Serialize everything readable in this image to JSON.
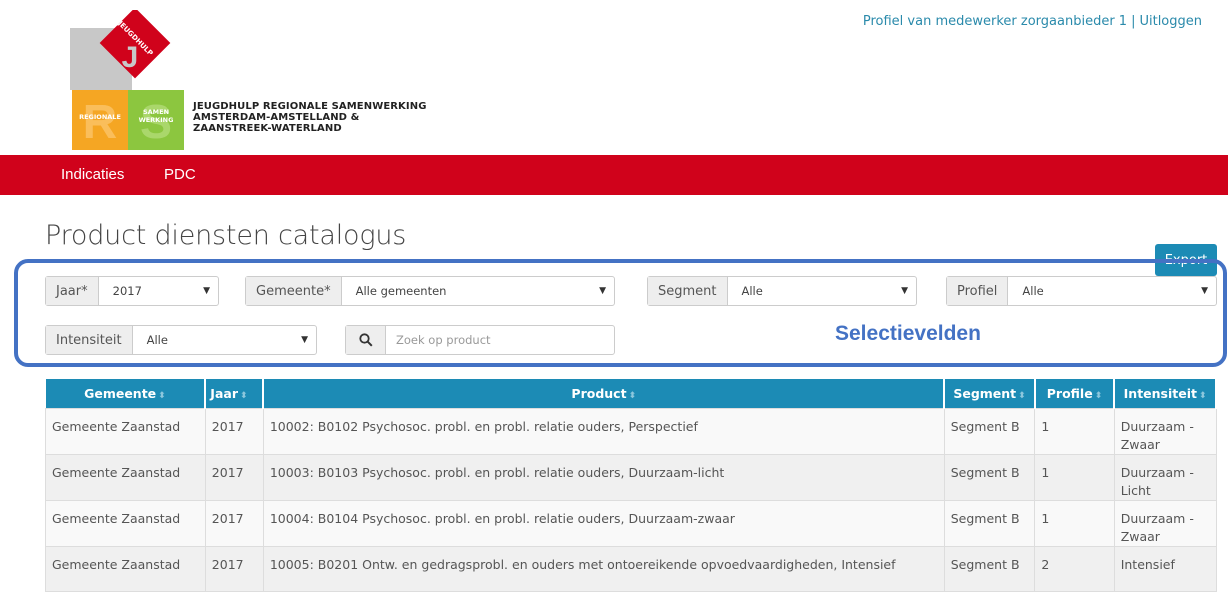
{
  "user_nav": {
    "profile_link": "Profiel van medewerker zorgaanbieder 1",
    "separator": "|",
    "logout_link": "Uitloggen"
  },
  "logo": {
    "badge_top": "JEUGDHULP",
    "letter_u": "J",
    "letter_r": "R",
    "letter_s": "S",
    "badge_left": "REGIONALE",
    "badge_right_1": "SAMEN",
    "badge_right_2": "WERKING",
    "text_lines": [
      "JEUGDHULP REGIONALE SAMENWERKING",
      "AMSTERDAM-AMSTELLAND &",
      "ZAANSTREEK-WATERLAND"
    ],
    "colors": {
      "red": "#d0021b",
      "grey": "#c8c8c8",
      "orange": "#f5a623",
      "green": "#8cc63f"
    }
  },
  "nav": {
    "items": [
      "Indicaties",
      "PDC"
    ],
    "color": "#d0021b"
  },
  "page": {
    "title": "Product diensten catalogus",
    "export_label": "Export"
  },
  "filters": {
    "jaar": {
      "label": "Jaar*",
      "value": "2017"
    },
    "gemeente": {
      "label": "Gemeente*",
      "value": "Alle gemeenten"
    },
    "segment": {
      "label": "Segment",
      "value": "Alle"
    },
    "profiel": {
      "label": "Profiel",
      "value": "Alle"
    },
    "intensiteit": {
      "label": "Intensiteit",
      "value": "Alle"
    },
    "search": {
      "placeholder": "Zoek op product"
    },
    "annotation": "Selectievelden"
  },
  "table": {
    "headers": [
      "Gemeente",
      "Jaar",
      "Product",
      "Segment",
      "Profile",
      "Intensiteit"
    ],
    "rows": [
      [
        "Gemeente Zaanstad",
        "2017",
        "10002: B0102 Psychosoc. probl. en probl. relatie ouders, Perspectief",
        "Segment B",
        "1",
        "Duurzaam - Zwaar"
      ],
      [
        "Gemeente Zaanstad",
        "2017",
        "10003: B0103 Psychosoc. probl. en probl. relatie ouders, Duurzaam-licht",
        "Segment B",
        "1",
        "Duurzaam - Licht"
      ],
      [
        "Gemeente Zaanstad",
        "2017",
        "10004: B0104 Psychosoc. probl. en probl. relatie ouders, Duurzaam-zwaar",
        "Segment B",
        "1",
        "Duurzaam - Zwaar"
      ],
      [
        "Gemeente Zaanstad",
        "2017",
        "10005: B0201 Ontw. en gedragsprobl. en ouders met ontoereikende opvoedvaardigheden, Intensief",
        "Segment B",
        "2",
        "Intensief"
      ]
    ]
  }
}
